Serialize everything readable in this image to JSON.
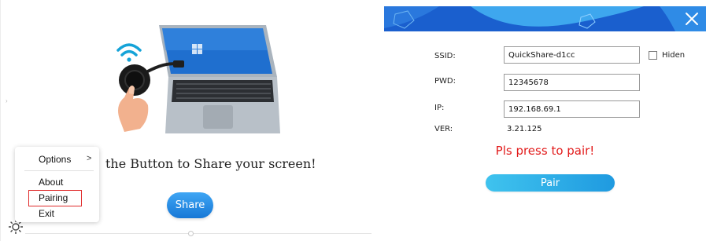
{
  "left_window": {
    "share_text": "the Button to Share your screen!",
    "share_button_label": "Share",
    "menu": {
      "options_label": "Options",
      "options_arrow": ">",
      "about_label": "About",
      "pairing_label": "Pairing",
      "exit_label": "Exit"
    }
  },
  "right_window": {
    "close_glyph": "×",
    "fields": {
      "ssid_label": "SSID:",
      "ssid_value": "QuickShare-d1cc",
      "pwd_label": "PWD:",
      "pwd_value": "12345678",
      "ip_label": "IP:",
      "ip_value": "192.168.69.1",
      "ver_label": "VER:",
      "ver_value": "3.21.125"
    },
    "hiden_label": "Hiden",
    "hiden_checked": false,
    "status_text": "Pls press to pair!",
    "pair_button_label": "Pair"
  },
  "colors": {
    "share_button": "#1677d6",
    "header_band": "#1a5fce",
    "status_text": "#e21b1b",
    "pair_button": "#26a8e6",
    "pairing_highlight": "#e02b2b"
  },
  "icons": [
    "wifi-icon",
    "laptop-illustration",
    "dongle-button-illustration",
    "hand-illustration",
    "gear-icon",
    "close-icon"
  ]
}
